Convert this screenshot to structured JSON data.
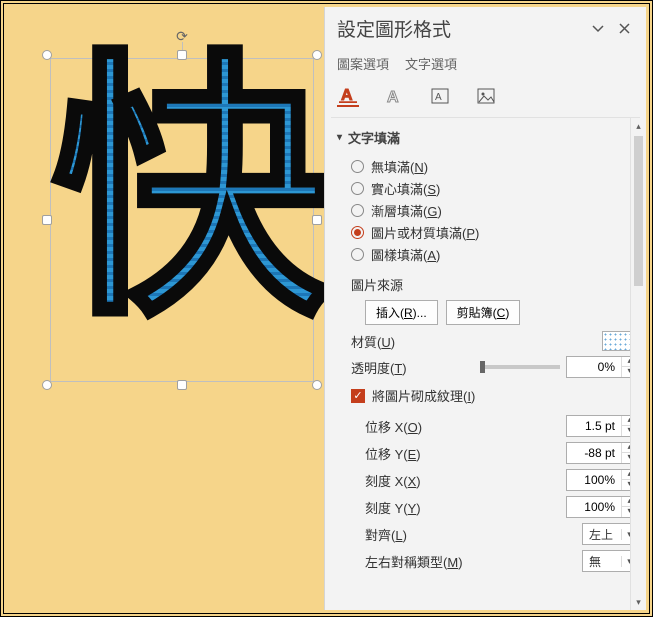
{
  "panel": {
    "title": "設定圖形格式",
    "tabs": {
      "shape_options": "圖案選項",
      "text_options": "文字選項"
    }
  },
  "section": {
    "title": "文字填滿"
  },
  "radios": {
    "none": {
      "pre": "無填滿(",
      "u": "N",
      "post": ")"
    },
    "solid": {
      "pre": "實心填滿(",
      "u": "S",
      "post": ")"
    },
    "grad": {
      "pre": "漸層填滿(",
      "u": "G",
      "post": ")"
    },
    "pic": {
      "pre": "圖片或材質填滿(",
      "u": "P",
      "post": ")"
    },
    "pattern": {
      "pre": "圖樣填滿(",
      "u": "A",
      "post": ")"
    }
  },
  "pic_source": {
    "label": "圖片來源",
    "insert": {
      "pre": "插入(",
      "u": "R",
      "post": ")..."
    },
    "clipboard": {
      "pre": "剪貼簿(",
      "u": "C",
      "post": ")"
    }
  },
  "texture": {
    "pre": "材質(",
    "u": "U",
    "post": ")"
  },
  "transparency": {
    "pre": "透明度(",
    "u": "T",
    "post": ")",
    "value": "0%"
  },
  "tile_check": {
    "pre": "將圖片砌成紋理(",
    "u": "I",
    "post": ")"
  },
  "offset_x": {
    "pre": "位移 X(",
    "u": "O",
    "post": ")",
    "value": "1.5 pt"
  },
  "offset_y": {
    "pre": "位移 Y(",
    "u": "E",
    "post": ")",
    "value": "-88 pt"
  },
  "scale_x": {
    "pre": "刻度 X(",
    "u": "X",
    "post": ")",
    "value": "100%"
  },
  "scale_y": {
    "pre": "刻度 Y(",
    "u": "Y",
    "post": ")",
    "value": "100%"
  },
  "align": {
    "pre": "對齊(",
    "u": "L",
    "post": ")",
    "value": "左上"
  },
  "mirror": {
    "pre": "左右對稱類型(",
    "u": "M",
    "post": ")",
    "value": "無"
  },
  "shape": {
    "character": "快"
  }
}
